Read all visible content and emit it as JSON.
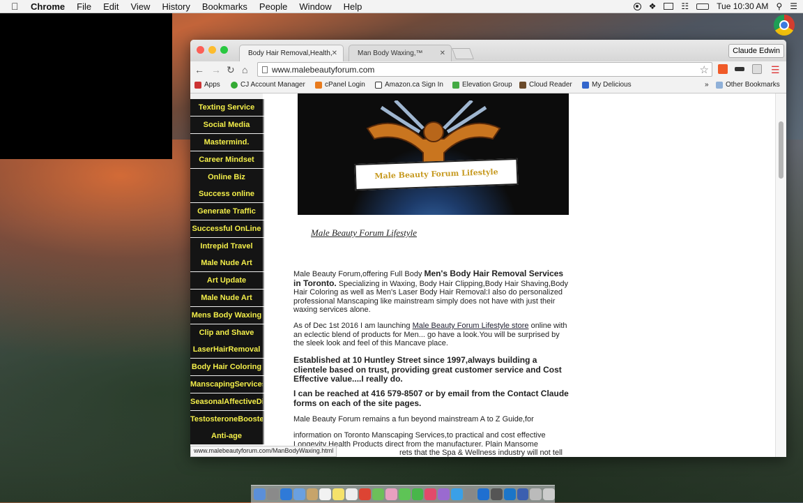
{
  "menubar": {
    "app": "Chrome",
    "items": [
      "File",
      "Edit",
      "View",
      "History",
      "Bookmarks",
      "People",
      "Window",
      "Help"
    ],
    "clock": "Tue 10:30 AM"
  },
  "browser": {
    "tabs": [
      {
        "title": "Body Hair Removal,Health,"
      },
      {
        "title": "Man Body Waxing,™"
      }
    ],
    "profile": "Claude Edwin",
    "url": "www.malebeautyforum.com",
    "bookmarks": [
      {
        "label": "Apps",
        "color": "#c33"
      },
      {
        "label": "CJ Account Manager",
        "color": "#3a3"
      },
      {
        "label": "cPanel Login",
        "color": "#e87a1c"
      },
      {
        "label": "Amazon.ca Sign In",
        "color": "#222"
      },
      {
        "label": "Elevation Group",
        "color": "#4a4"
      },
      {
        "label": "Cloud Reader",
        "color": "#6a4a2a"
      },
      {
        "label": "My Delicious",
        "color": "#3366cc"
      }
    ],
    "other_bookmarks": "Other Bookmarks",
    "status_url": "www.malebeautyforum.com/ManBodyWaxing.html"
  },
  "sidebar": {
    "links": [
      "Texting Service",
      "Social Media",
      "Mastermind.",
      "Career Mindset",
      "Online Biz",
      "Success online",
      "Generate Traffic",
      "Successful OnLine",
      "Intrepid Travel",
      "Male Nude Art",
      "Art Update",
      "Male Nude Art",
      "Mens Body Waxing",
      "Clip and Shave",
      "LaserHairRemoval",
      "Body Hair Coloring",
      "ManscapingServices",
      "SeasonalAffectiveDi",
      "TestosteroneBooste",
      "Anti-age"
    ]
  },
  "main": {
    "banner_text": "Male Beauty Forum Lifestyle",
    "caption": "Male Beauty Forum Lifestyle",
    "p1_intro": "Male Beauty Forum,offering Full Body ",
    "p1_bold": "Men's Body Hair Removal Services in Toronto.",
    "p1_rest": " Specializing in Waxing, Body Hair Clipping,Body Hair Shaving,Body Hair Coloring as well as Men's Laser Body Hair Removal:I also do personalized professional Manscaping like mainstream simply does not have with just their waxing services alone.",
    "p2_intro": "As of Dec 1st 2016 I am launching ",
    "p2_link": "Male Beauty Forum Lifestyle store",
    "p2_rest": " online with an eclectic blend of products for Men... go have a look.You will be surprised by the sleek look and feel of this Mancave place.",
    "p3": "Established at 10 Huntley Street since 1997,always building a clientele based on trust, providing great customer service and Cost Effective value....I really do.",
    "p4": "I can be reached at 416 579-8507 or by email from the Contact Claude forms on each of the site pages.",
    "p5": "Male Beauty Forum remains a fun beyond mainstream A to Z Guide,for",
    "p6": "information on Toronto Manscaping Services,to practical and cost effective Longevity Health Products direct from the manufacturer. Plain Mansome",
    "p7_tail": "rets that the Spa & Wellness industry will not tell"
  }
}
